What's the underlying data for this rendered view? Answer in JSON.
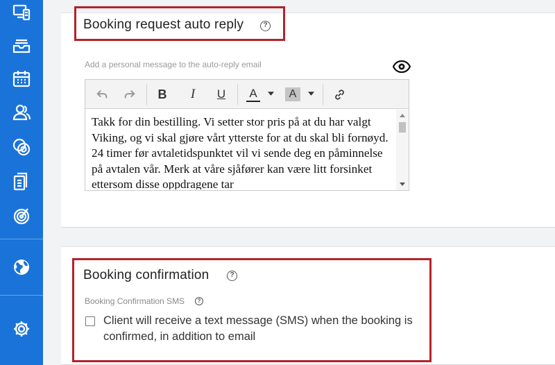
{
  "sidebar": {
    "items": [
      {
        "icon": "devices-icon"
      },
      {
        "icon": "inbox-icon"
      },
      {
        "icon": "calendar-icon"
      },
      {
        "icon": "users-icon"
      },
      {
        "icon": "coins-icon"
      },
      {
        "icon": "documents-icon"
      },
      {
        "icon": "target-icon"
      },
      {
        "icon": "globe-icon"
      },
      {
        "icon": "settings-icon"
      }
    ]
  },
  "auto_reply": {
    "title": "Booking request auto reply",
    "help": "?",
    "hint": "Add a personal message to the auto-reply email",
    "preview_icon": "eye-icon",
    "toolbar": {
      "undo": "undo-icon",
      "redo": "redo-icon",
      "bold": "B",
      "italic": "I",
      "underline": "U",
      "font_color": "A",
      "highlight": "A",
      "link": "link-icon"
    },
    "message": "Takk for din bestilling. Vi setter stor pris på at du har valgt Viking, og vi skal gjøre vårt ytterste for at du skal bli fornøyd. 24 timer før avtaletidspunktet vil vi sende deg en påminnelse på avtalen vår. Merk at våre sjåfører kan være litt forsinket ettersom disse oppdragene tar"
  },
  "confirmation": {
    "title": "Booking confirmation",
    "help": "?",
    "sms_label": "Booking Confirmation SMS",
    "sms_help": "?",
    "checkbox_label": "Client will receive a text message (SMS) when the booking is confirmed, in addition to email",
    "checkbox_checked": false
  },
  "colors": {
    "sidebar": "#1a73d8",
    "highlight_border": "#b5212a"
  }
}
